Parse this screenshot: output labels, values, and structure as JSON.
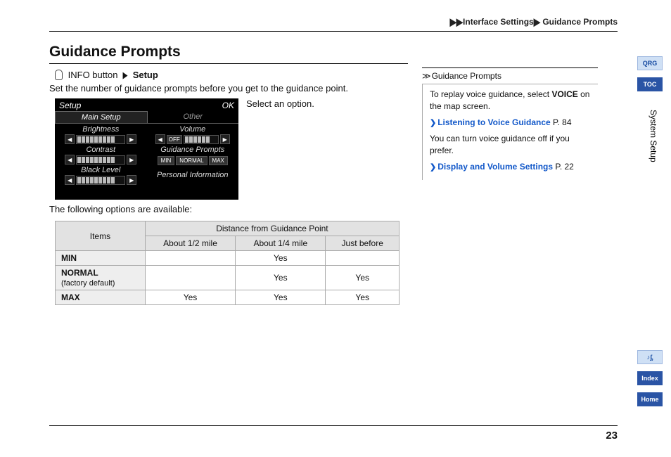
{
  "breadcrumb": {
    "sep": "▶▶",
    "mid": "Interface Settings",
    "sep2": "▶",
    "leaf": "Guidance Prompts"
  },
  "title": "Guidance Prompts",
  "nav": {
    "info": "INFO button",
    "setup": "Setup"
  },
  "intro": "Set the number of guidance prompts before you get to the guidance point.",
  "select": "Select an option.",
  "screenshot": {
    "setup": "Setup",
    "ok": "OK",
    "tab_main": "Main Setup",
    "tab_other": "Other",
    "brightness": "Brightness",
    "contrast": "Contrast",
    "black": "Black Level",
    "volume": "Volume",
    "off": "OFF",
    "gp": "Guidance Prompts",
    "min": "MIN",
    "normal": "NORMAL",
    "max": "MAX",
    "pi": "Personal Information"
  },
  "avail": "The following options are available:",
  "table": {
    "items_hdr": "Items",
    "dist_hdr": "Distance from Guidance Point",
    "c1": "About 1/2 mile",
    "c2": "About 1/4 mile",
    "c3": "Just before",
    "rows": [
      {
        "name": "MIN",
        "sub": "",
        "v": [
          "",
          "Yes",
          ""
        ]
      },
      {
        "name": "NORMAL",
        "sub": "(factory default)",
        "v": [
          "",
          "Yes",
          "Yes"
        ]
      },
      {
        "name": "MAX",
        "sub": "",
        "v": [
          "Yes",
          "Yes",
          "Yes"
        ]
      }
    ]
  },
  "side": {
    "title": "Guidance Prompts",
    "p1a": "To replay voice guidance, select ",
    "p1b": "VOICE",
    "p1c": " on the map screen.",
    "link1": "Listening to Voice Guidance",
    "link1_p": "P. 84",
    "p2": "You can turn voice guidance off if you prefer.",
    "link2": "Display and Volume Settings",
    "link2_p": "P. 22"
  },
  "sidetabs": {
    "qrg": "QRG",
    "toc": "TOC",
    "voice": "♪ᶋ",
    "index": "Index",
    "home": "Home"
  },
  "section": "System Setup",
  "pagenum": "23"
}
